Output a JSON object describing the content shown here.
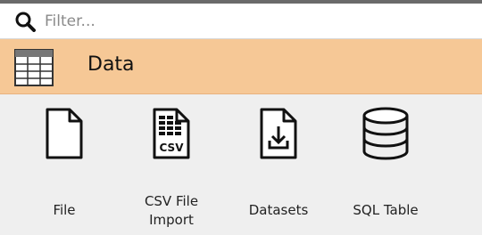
{
  "filter": {
    "placeholder": "Filter...",
    "value": ""
  },
  "category": {
    "title": "Data",
    "icon": "table-icon",
    "color": "#f6c896"
  },
  "widgets": [
    {
      "label": "File",
      "icon": "file-icon"
    },
    {
      "label": "CSV File\nImport",
      "icon": "csv-file-icon"
    },
    {
      "label": "Datasets",
      "icon": "download-document-icon"
    },
    {
      "label": "SQL Table",
      "icon": "database-icon"
    }
  ]
}
